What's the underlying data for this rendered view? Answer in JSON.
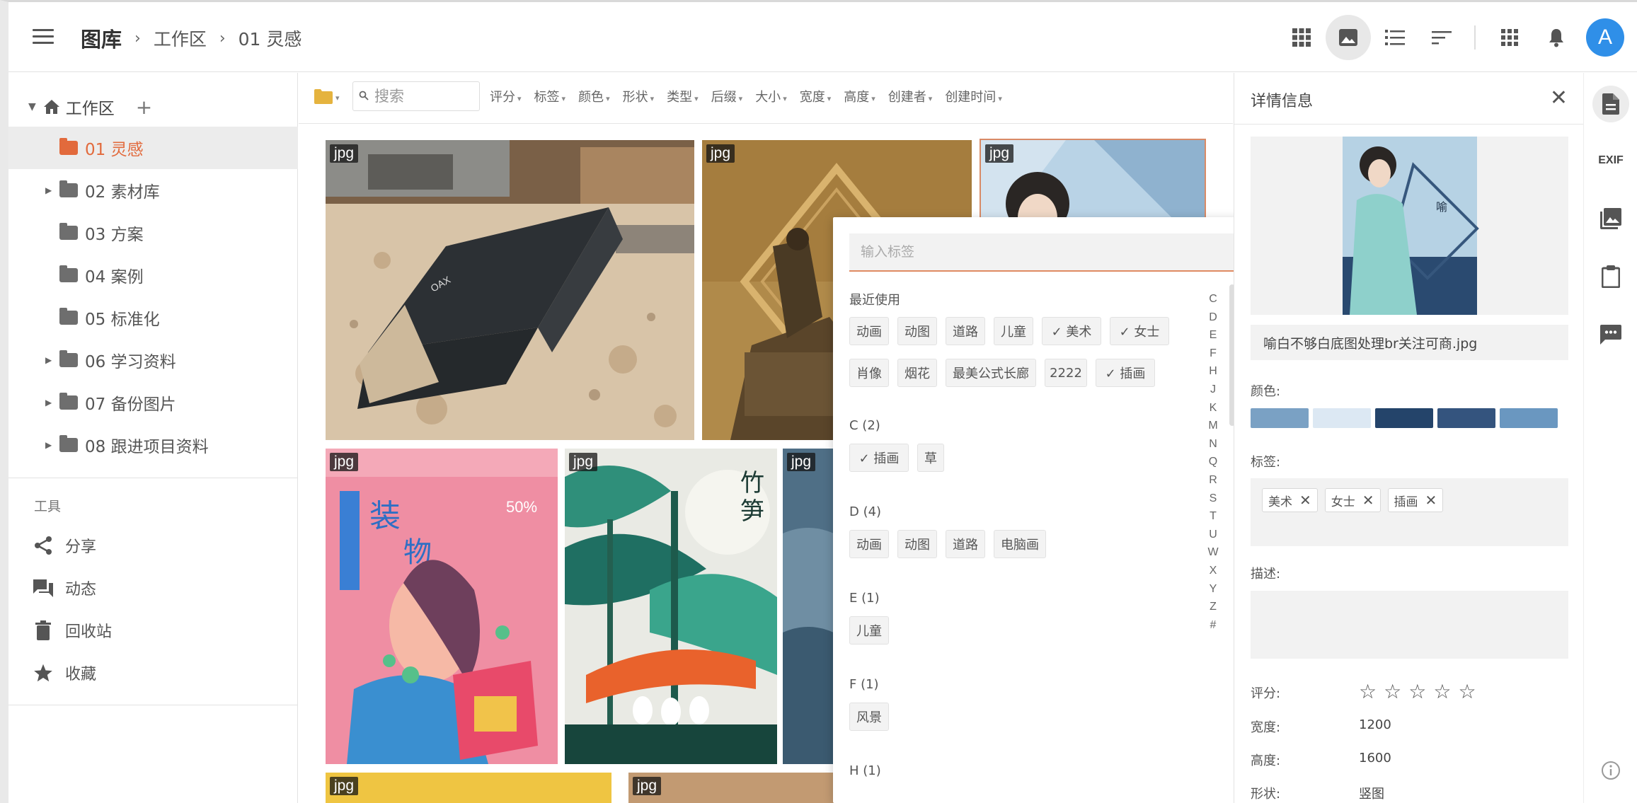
{
  "header": {
    "app_title": "图库",
    "breadcrumb": [
      "工作区",
      "01 灵感"
    ],
    "avatar_letter": "A",
    "icons": [
      "grid-view-icon",
      "image-view-icon",
      "list-view-icon",
      "sort-icon",
      "apps-icon",
      "bell-icon"
    ]
  },
  "sidebar": {
    "workspace_label": "工作区",
    "add_symbol": "+",
    "folders": [
      {
        "label": "01 灵感",
        "active": true,
        "expandable": false
      },
      {
        "label": "02 素材库",
        "active": false,
        "expandable": true
      },
      {
        "label": "03 方案",
        "active": false,
        "expandable": false
      },
      {
        "label": "04 案例",
        "active": false,
        "expandable": false
      },
      {
        "label": "05 标准化",
        "active": false,
        "expandable": false
      },
      {
        "label": "06 学习资料",
        "active": false,
        "expandable": true
      },
      {
        "label": "07 备份图片",
        "active": false,
        "expandable": true
      },
      {
        "label": "08 跟进项目资料",
        "active": false,
        "expandable": true
      }
    ],
    "tools_title": "工具",
    "tools": [
      {
        "label": "分享",
        "icon": "share-icon"
      },
      {
        "label": "动态",
        "icon": "activity-icon"
      },
      {
        "label": "回收站",
        "icon": "trash-icon"
      },
      {
        "label": "收藏",
        "icon": "star-icon"
      }
    ]
  },
  "filterbar": {
    "search_placeholder": "搜索",
    "filters": [
      "评分",
      "标签",
      "颜色",
      "形状",
      "类型",
      "后缀",
      "大小",
      "宽度",
      "高度",
      "创建者",
      "创建时间"
    ]
  },
  "grid": {
    "badge": "jpg"
  },
  "tag_popup": {
    "input_placeholder": "输入标签",
    "recent_title": "最近使用",
    "recent_tags": [
      "动画",
      "动图",
      "道路",
      "儿童",
      "✓ 美术",
      "✓ 女士",
      "肖像",
      "烟花",
      "最美公式长廊",
      "2222",
      "✓ 插画"
    ],
    "sections": [
      {
        "title": "C (2)",
        "tags": [
          "✓ 插画",
          "草"
        ]
      },
      {
        "title": "D (4)",
        "tags": [
          "动画",
          "动图",
          "道路",
          "电脑画"
        ]
      },
      {
        "title": "E (1)",
        "tags": [
          "儿童"
        ]
      },
      {
        "title": "F (1)",
        "tags": [
          "风景"
        ]
      },
      {
        "title": "H (1)",
        "tags": []
      }
    ],
    "alphabet": [
      "C",
      "D",
      "E",
      "F",
      "H",
      "J",
      "K",
      "M",
      "N",
      "Q",
      "R",
      "S",
      "T",
      "U",
      "W",
      "X",
      "Y",
      "Z",
      "#"
    ]
  },
  "details": {
    "title": "详情信息",
    "filename": "喻白不够白底图处理br关注可商.jpg",
    "color_label": "颜色:",
    "colors": [
      "#7aa1c4",
      "#dce8f3",
      "#24446a",
      "#34547e",
      "#6a97c0"
    ],
    "tags_label": "标签:",
    "tags": [
      "美术",
      "女士",
      "插画"
    ],
    "desc_label": "描述:",
    "rating_label": "评分:",
    "rating": 0,
    "width_label": "宽度:",
    "width_value": "1200",
    "height_label": "高度:",
    "height_value": "1600",
    "shape_label": "形状:",
    "shape_value": "竖图"
  },
  "rail": {
    "exif_label": "EXIF"
  }
}
